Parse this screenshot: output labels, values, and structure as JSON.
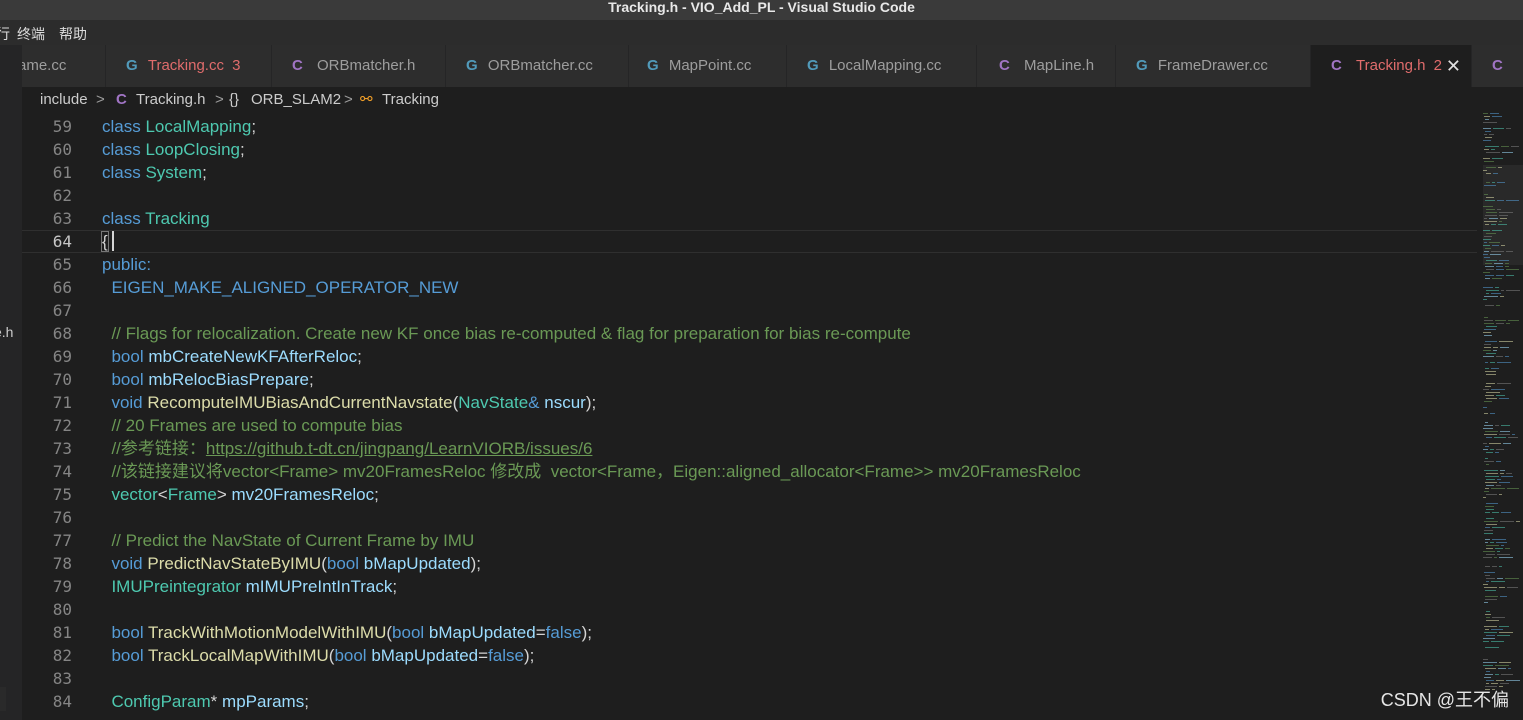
{
  "window": {
    "title": "Tracking.h - VIO_Add_PL - Visual Studio Code"
  },
  "menu": {
    "items": [
      "行",
      "终端",
      "帮助"
    ]
  },
  "left_strip": {
    "label_file": "e.h"
  },
  "tabs": [
    {
      "icon": "",
      "label": "ame.cc",
      "count": ""
    },
    {
      "icon": "G",
      "label": "Tracking.cc",
      "count": "3"
    },
    {
      "icon": "C",
      "label": "ORBmatcher.h",
      "count": ""
    },
    {
      "icon": "G",
      "label": "ORBmatcher.cc",
      "count": ""
    },
    {
      "icon": "G",
      "label": "MapPoint.cc",
      "count": ""
    },
    {
      "icon": "G",
      "label": "LocalMapping.cc",
      "count": ""
    },
    {
      "icon": "C",
      "label": "MapLine.h",
      "count": ""
    },
    {
      "icon": "G",
      "label": "FrameDrawer.cc",
      "count": ""
    },
    {
      "icon": "C",
      "label": "Tracking.h",
      "count": "2"
    },
    {
      "icon": "C",
      "label": "",
      "count": ""
    }
  ],
  "breadcrumb": {
    "folder": "include",
    "file_icon": "C",
    "file": "Tracking.h",
    "namespace_icon": "{}",
    "namespace": "ORB_SLAM2",
    "class": "Tracking",
    "sep": ">"
  },
  "editor": {
    "line_numbers": [
      "59",
      "60",
      "61",
      "62",
      "63",
      "64",
      "65",
      "66",
      "67",
      "68",
      "69",
      "70",
      "71",
      "72",
      "73",
      "74",
      "75",
      "76",
      "77",
      "78",
      "79",
      "80",
      "81",
      "82",
      "83",
      "84"
    ],
    "t": {
      "class": "class",
      "LocalMapping": "LocalMapping",
      "LoopClosing": "LoopClosing",
      "System": "System",
      "Tracking": "Tracking",
      "semi": ";",
      "lbrace": "{",
      "public": "public:",
      "eigen": "EIGEN_MAKE_ALIGNED_OPERATOR_NEW",
      "c68": "// Flags for relocalization. Create new KF once bias re-computed & flag for preparation for bias re-compute",
      "bool": "bool",
      "void": "void",
      "mbCreateNewKFAfterReloc": "mbCreateNewKFAfterReloc",
      "mbRelocBiasPrepare": "mbRelocBiasPrepare",
      "RecomputeIMUBiasAndCurrentNavstate": "RecomputeIMUBiasAndCurrentNavstate",
      "lparen": "(",
      "NavState": "NavState",
      "amp": "&",
      "nscur": "nscur",
      "rparen_semi": ");",
      "c72": "// 20 Frames are used to compute bias",
      "c73_prefix": "//参考链接：",
      "c73_link": "https://github.t-dt.cn/jingpang/LearnVIORB/issues/6",
      "c74": "//该链接建议将vector<Frame> mv20FramesReloc 修改成  vector<Frame，Eigen::aligned_allocator<Frame>> mv20FramesReloc",
      "vector": "vector",
      "lt": "<",
      "Frame": "Frame",
      "gt": ">",
      "mv20FramesReloc": "mv20FramesReloc",
      "c77": "// Predict the NavState of Current Frame by IMU",
      "PredictNavStateByIMU": "PredictNavStateByIMU",
      "bMapUpdated": "bMapUpdated",
      "IMUPreintegrator": "IMUPreintegrator",
      "mIMUPreIntInTrack": "mIMUPreIntInTrack",
      "TrackWithMotionModelWithIMU": "TrackWithMotionModelWithIMU",
      "eq": "=",
      "false": "false",
      "TrackLocalMapWithIMU": "TrackLocalMapWithIMU",
      "ConfigParam": "ConfigParam",
      "star": "*",
      "mpParams": "mpParams"
    }
  },
  "watermark": "CSDN @王不偏",
  "colors": {
    "keyword": "#569cd6",
    "type": "#4ec9b0",
    "function": "#dcdcaa",
    "variable": "#9cdcfe",
    "comment": "#6a9955",
    "modified_tab": "#e06c6c",
    "editor_bg": "#1e1e1e"
  }
}
